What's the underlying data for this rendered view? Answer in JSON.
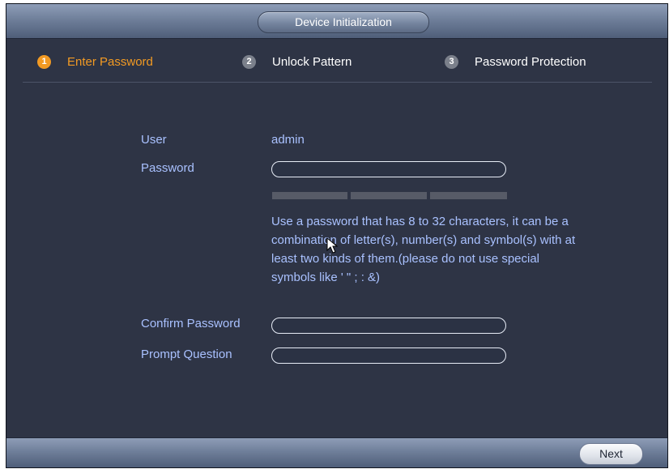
{
  "window": {
    "title": "Device Initialization"
  },
  "steps": [
    {
      "number": "1",
      "label": "Enter Password",
      "active": true
    },
    {
      "number": "2",
      "label": "Unlock Pattern",
      "active": false
    },
    {
      "number": "3",
      "label": "Password Protection",
      "active": false
    }
  ],
  "form": {
    "user_label": "User",
    "user_value": "admin",
    "password_label": "Password",
    "password_value": "",
    "hint": "Use a password that has 8 to 32 characters, it can be a combination of letter(s), number(s) and symbol(s) with at least two kinds of them.(please do not use special symbols like ' \" ; : &)",
    "confirm_label": "Confirm Password",
    "confirm_value": "",
    "prompt_label": "Prompt Question",
    "prompt_value": ""
  },
  "footer": {
    "next_label": "Next"
  },
  "colors": {
    "accent": "#f29a23",
    "label_text": "#a9c1ff",
    "background": "#2e3445"
  },
  "icons": {
    "cursor": "mouse-pointer-icon"
  }
}
